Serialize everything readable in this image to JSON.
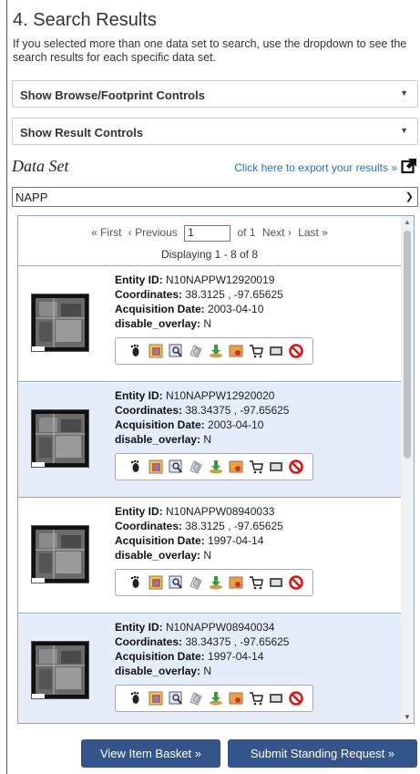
{
  "section": {
    "title": "4. Search Results",
    "description": "If you selected more than one data set to search, use the dropdown to see the search results for each specific data set."
  },
  "controls": {
    "browse_footprint": "Show Browse/Footprint Controls",
    "result_controls": "Show Result Controls",
    "caret_icon": "triangle-down-icon"
  },
  "dataset": {
    "label": "Data Set",
    "export_link": "Click here to export your results »",
    "export_icon": "external-link-icon",
    "selected": "NAPP"
  },
  "pager": {
    "first": "« First",
    "previous": "‹ Previous",
    "page_value": "1",
    "of_pages": "of 1",
    "next": "Next ›",
    "last": "Last »",
    "displaying": "Displaying 1 - 8 of 8"
  },
  "labels": {
    "entity_id": "Entity ID:",
    "coordinates": "Coordinates:",
    "acquisition_date": "Acquisition Date:",
    "disable_overlay": "disable_overlay:"
  },
  "results": [
    {
      "entity_id": "N10NAPPW12920019",
      "coordinates": "38.3125 , -97.65625",
      "date": "2003-04-10",
      "disable_overlay": "N"
    },
    {
      "entity_id": "N10NAPPW12920020",
      "coordinates": "38.34375 , -97.65625",
      "date": "2003-04-10",
      "disable_overlay": "N"
    },
    {
      "entity_id": "N10NAPPW08940033",
      "coordinates": "38.3125 , -97.65625",
      "date": "1997-04-14",
      "disable_overlay": "N"
    },
    {
      "entity_id": "N10NAPPW08940034",
      "coordinates": "38.34375 , -97.65625",
      "date": "1997-04-14",
      "disable_overlay": "N"
    }
  ],
  "result_icons": [
    "footprint-icon",
    "overlay-icon",
    "metadata-icon",
    "compare-icon",
    "download-icon",
    "order-icon",
    "cart-icon",
    "exclude-icon",
    "hide-icon"
  ],
  "buttons": {
    "view_basket": "View Item Basket »",
    "standing_request": "Submit Standing Request »"
  },
  "colors": {
    "accent": "#33558b",
    "link": "#2a6ebb",
    "alt_row": "#e4edf9"
  }
}
